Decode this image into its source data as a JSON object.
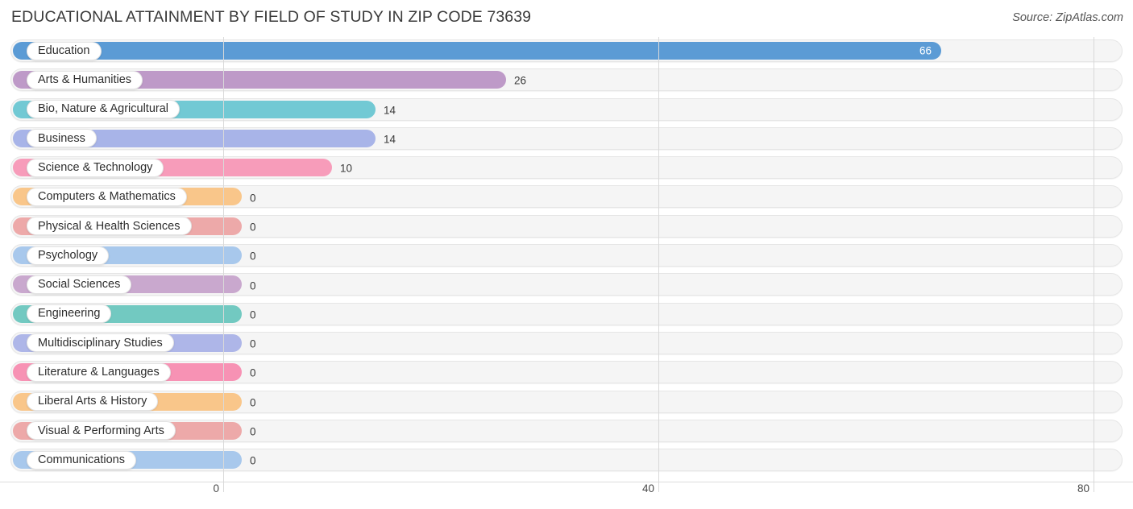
{
  "header": {
    "title": "EDUCATIONAL ATTAINMENT BY FIELD OF STUDY IN ZIP CODE 73639",
    "source": "Source: ZipAtlas.com"
  },
  "chart_data": {
    "type": "bar",
    "orientation": "horizontal",
    "title": "EDUCATIONAL ATTAINMENT BY FIELD OF STUDY IN ZIP CODE 73639",
    "xlabel": "",
    "ylabel": "",
    "xlim": [
      0,
      80
    ],
    "xticks": [
      0,
      40,
      80
    ],
    "xtick_labels": [
      "0",
      "40",
      "80"
    ],
    "grid": true,
    "legend": false,
    "categories": [
      "Education",
      "Arts & Humanities",
      "Bio, Nature & Agricultural",
      "Business",
      "Science & Technology",
      "Computers & Mathematics",
      "Physical & Health Sciences",
      "Psychology",
      "Social Sciences",
      "Engineering",
      "Multidisciplinary Studies",
      "Literature & Languages",
      "Liberal Arts & History",
      "Visual & Performing Arts",
      "Communications"
    ],
    "values": [
      66,
      26,
      14,
      14,
      10,
      0,
      0,
      0,
      0,
      0,
      0,
      0,
      0,
      0,
      0
    ],
    "value_labels": [
      "66",
      "26",
      "14",
      "14",
      "10",
      "0",
      "0",
      "0",
      "0",
      "0",
      "0",
      "0",
      "0",
      "0",
      "0"
    ],
    "colors": [
      "#5B9BD5",
      "#BE9AC8",
      "#72C9D4",
      "#A8B4E8",
      "#F79CBA",
      "#F9C68A",
      "#EDA9A9",
      "#A8C8EC",
      "#C9A8CE",
      "#72C9C1",
      "#AEB6E8",
      "#F792B4",
      "#F9C68A",
      "#EDA9A9",
      "#A8C8EC"
    ]
  },
  "bars": [
    {
      "label": "Education",
      "value": 66,
      "value_label": "66",
      "color": "#5B9BD5",
      "inside": true
    },
    {
      "label": "Arts & Humanities",
      "value": 26,
      "value_label": "26",
      "color": "#BE9AC8",
      "inside": false
    },
    {
      "label": "Bio, Nature & Agricultural",
      "value": 14,
      "value_label": "14",
      "color": "#72C9D4",
      "inside": false
    },
    {
      "label": "Business",
      "value": 14,
      "value_label": "14",
      "color": "#A8B4E8",
      "inside": false
    },
    {
      "label": "Science & Technology",
      "value": 10,
      "value_label": "10",
      "color": "#F79CBA",
      "inside": false
    },
    {
      "label": "Computers & Mathematics",
      "value": 0,
      "value_label": "0",
      "color": "#F9C68A",
      "inside": false
    },
    {
      "label": "Physical & Health Sciences",
      "value": 0,
      "value_label": "0",
      "color": "#EDA9A9",
      "inside": false
    },
    {
      "label": "Psychology",
      "value": 0,
      "value_label": "0",
      "color": "#A8C8EC",
      "inside": false
    },
    {
      "label": "Social Sciences",
      "value": 0,
      "value_label": "0",
      "color": "#C9A8CE",
      "inside": false
    },
    {
      "label": "Engineering",
      "value": 0,
      "value_label": "0",
      "color": "#72C9C1",
      "inside": false
    },
    {
      "label": "Multidisciplinary Studies",
      "value": 0,
      "value_label": "0",
      "color": "#AEB6E8",
      "inside": false
    },
    {
      "label": "Literature & Languages",
      "value": 0,
      "value_label": "0",
      "color": "#F792B4",
      "inside": false
    },
    {
      "label": "Liberal Arts & History",
      "value": 0,
      "value_label": "0",
      "color": "#F9C68A",
      "inside": false
    },
    {
      "label": "Visual & Performing Arts",
      "value": 0,
      "value_label": "0",
      "color": "#EDA9A9",
      "inside": false
    },
    {
      "label": "Communications",
      "value": 0,
      "value_label": "0",
      "color": "#A8C8EC",
      "inside": false
    }
  ],
  "axis": {
    "ticks": [
      {
        "label": "0",
        "value": 0
      },
      {
        "label": "40",
        "value": 40
      },
      {
        "label": "80",
        "value": 80
      }
    ]
  }
}
